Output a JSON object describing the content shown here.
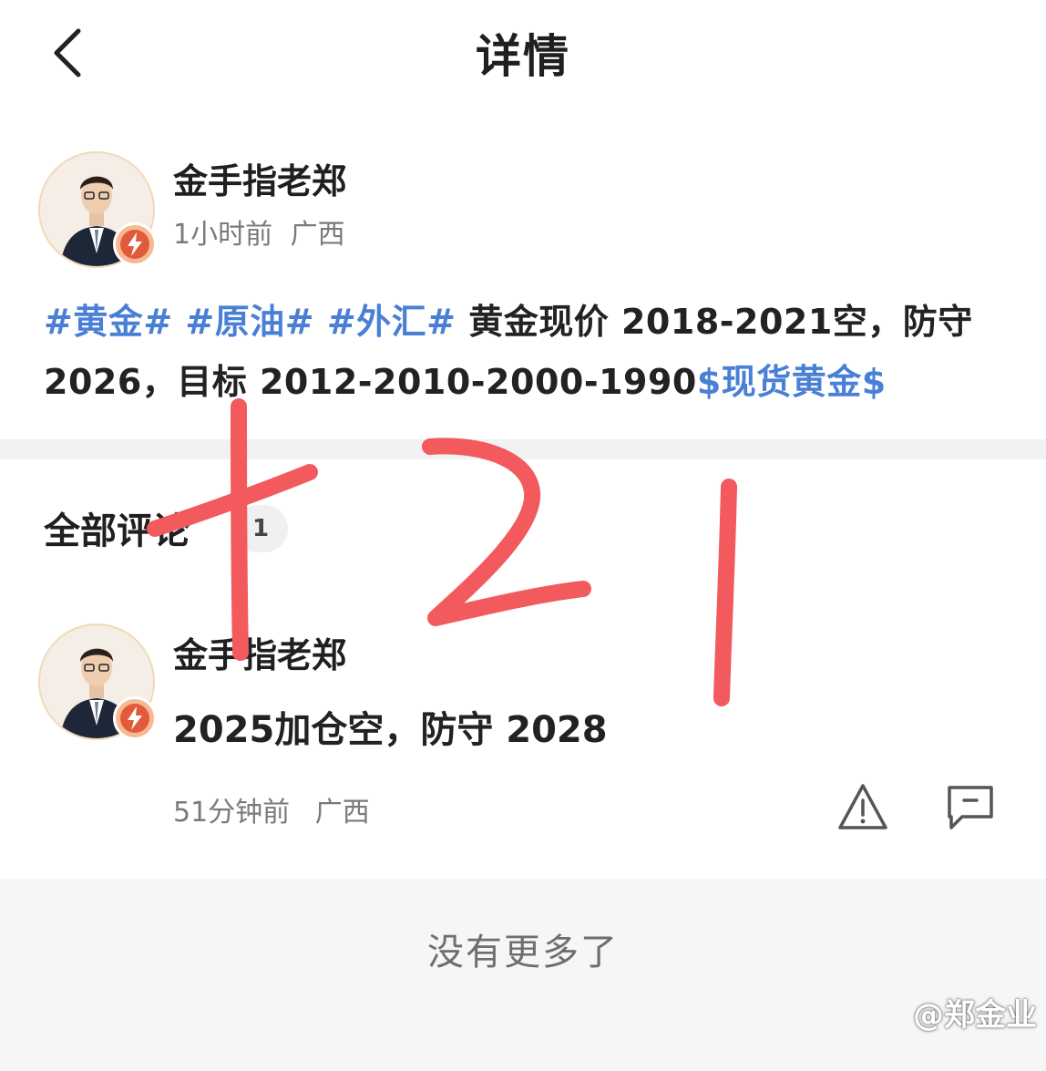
{
  "nav": {
    "title": "详情"
  },
  "post": {
    "author": "金手指老郑",
    "time": "1小时前",
    "location": "广西",
    "tags": [
      "#黄金#",
      "#原油#",
      "#外汇#"
    ],
    "text": "黄金现价 2018-2021空，防守 2026，目标 2012-2010-2000-1990",
    "stock_tag": "$现货黄金$"
  },
  "comments": {
    "header": "全部评论",
    "count": "1",
    "items": [
      {
        "author": "金手指老郑",
        "text": "2025加仓空，防守 2028",
        "time": "51分钟前",
        "location": "广西"
      }
    ]
  },
  "footer": {
    "no_more": "没有更多了"
  },
  "watermark": "@郑金业",
  "handwriting": "121",
  "colors": {
    "tag": "#4a7fd6",
    "handwriting": "#f25a5e",
    "divider": "#f2f2f2",
    "footer_bg": "#f6f6f6"
  },
  "icons": {
    "back": "chevron-left-icon",
    "report": "warning-triangle-icon",
    "reply": "comment-bubble-icon",
    "badge": "lightning-badge-icon"
  }
}
